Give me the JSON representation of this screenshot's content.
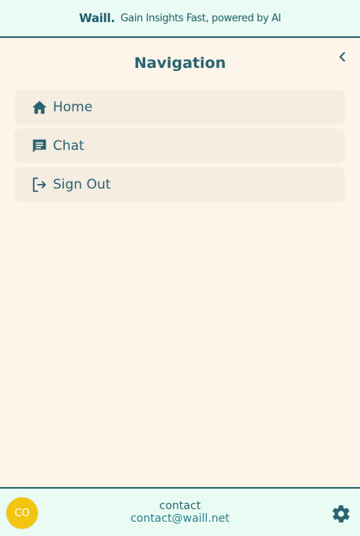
{
  "header": {
    "brand": "Waill.",
    "tagline": "Gain Insights Fast, powered by AI"
  },
  "nav": {
    "title": "Navigation",
    "collapse_icon": "chevron-left-icon",
    "items": [
      {
        "label": "Home",
        "icon": "home-icon"
      },
      {
        "label": "Chat",
        "icon": "chat-icon"
      },
      {
        "label": "Sign Out",
        "icon": "sign-out-icon"
      }
    ]
  },
  "footer": {
    "avatar_initials": "CO",
    "user_name": "contact",
    "user_email": "contact@waill.net",
    "settings_icon": "gear-icon"
  },
  "colors": {
    "primary": "#2a6470",
    "background": "#fdf5ea",
    "header_bg": "#e9fbf3",
    "nav_item_bg": "#f5ece2",
    "avatar_bg": "#f2c511"
  }
}
